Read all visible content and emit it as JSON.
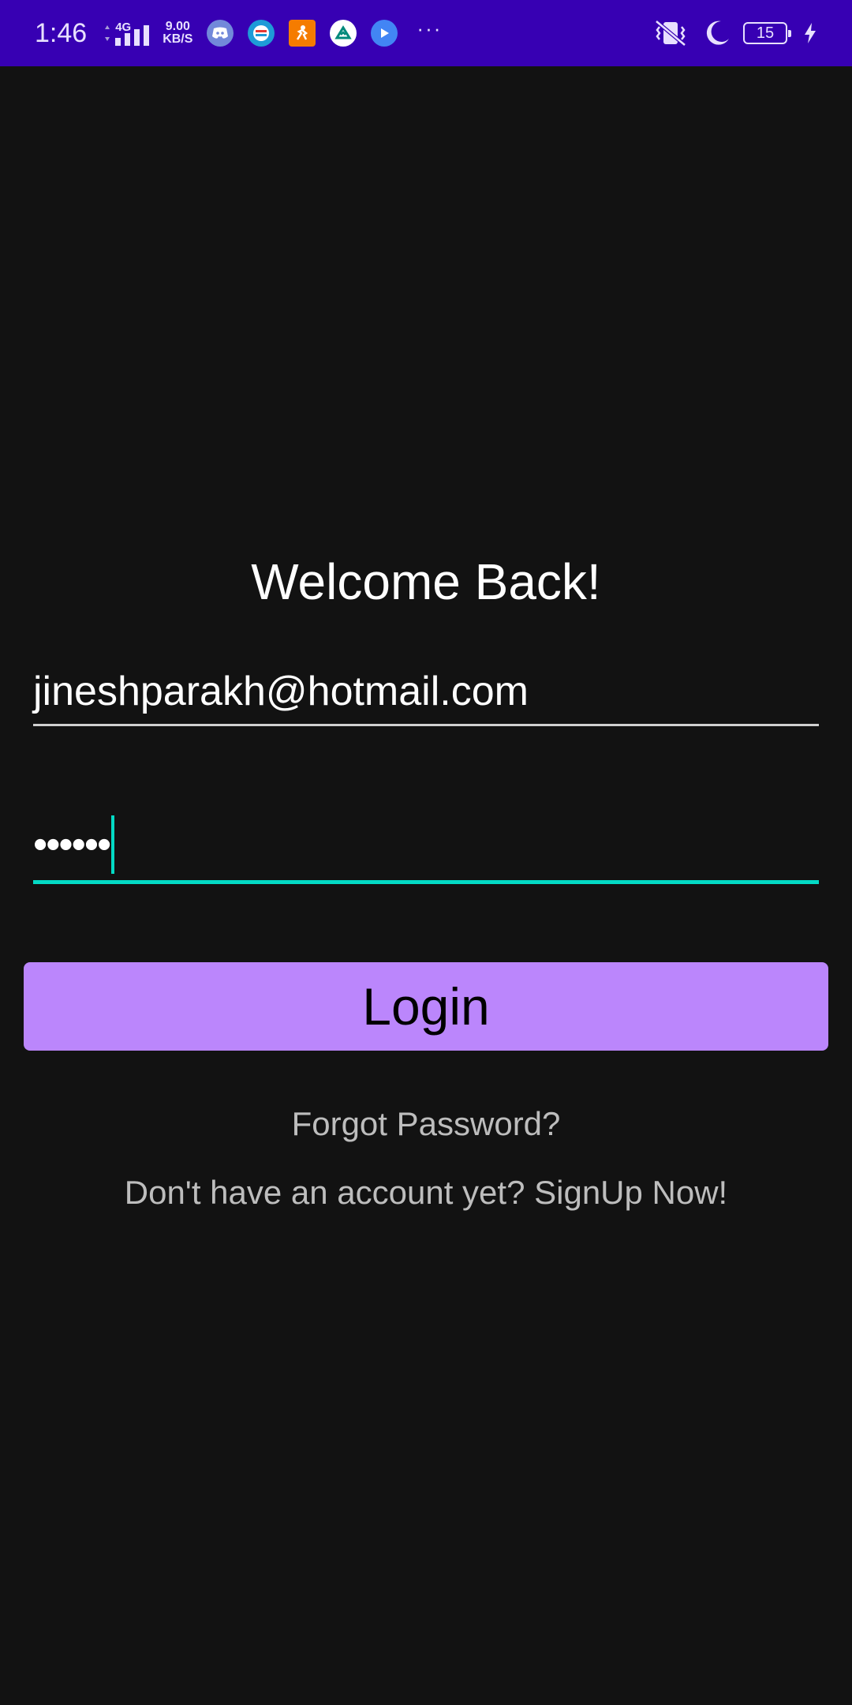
{
  "status_bar": {
    "time": "1:46",
    "network_type": "4G",
    "speed_value": "9.00",
    "speed_unit": "KB/S",
    "battery_level": "15",
    "notification_icons": [
      "discord-icon",
      "app-icon-blue",
      "app-icon-orange",
      "app-icon-green",
      "play-icon"
    ],
    "status_icons": [
      "vibrate-icon",
      "moon-icon",
      "battery-icon",
      "charging-icon"
    ],
    "background_color": "#3700b3"
  },
  "login": {
    "title": "Welcome Back!",
    "email_value": "jineshparakh@hotmail.com",
    "password_value": "••••••",
    "login_label": "Login",
    "forgot_password_label": "Forgot Password?",
    "signup_label": "Don't have an account yet? SignUp Now!"
  },
  "colors": {
    "background": "#121212",
    "primary": "#bb86fc",
    "accent": "#03dac5"
  }
}
